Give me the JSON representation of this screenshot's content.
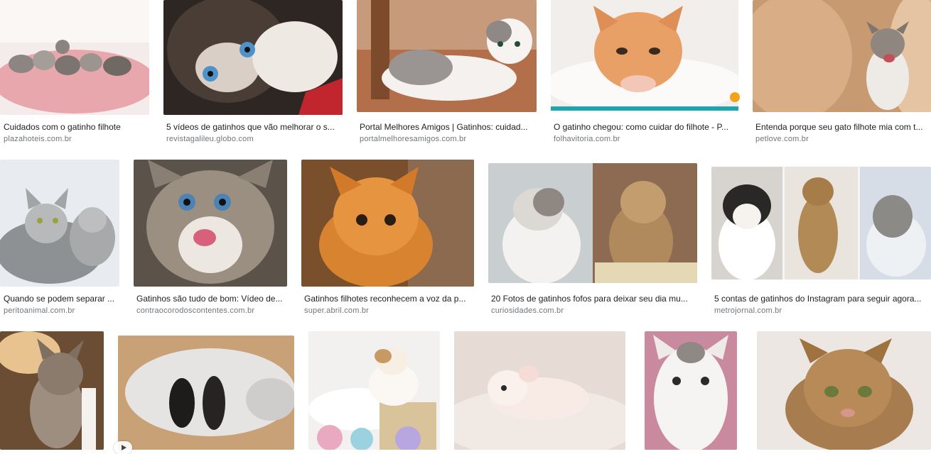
{
  "results": [
    {
      "title": "Cuidados com o gatinho filhote",
      "source": "plazahoteis.com.br"
    },
    {
      "title": "5 vídeos de gatinhos que vão melhorar o s...",
      "source": "revistagalileu.globo.com"
    },
    {
      "title": "Portal Melhores Amigos | Gatinhos: cuidad...",
      "source": "portalmelhoresamigos.com.br"
    },
    {
      "title": "O gatinho chegou: como cuidar do filhote - P...",
      "source": "folhavitoria.com.br"
    },
    {
      "title": "Entenda porque seu gato filhote mia com t...",
      "source": "petlove.com.br"
    },
    {
      "title": "Quando se podem separar ...",
      "source": "peritoanimal.com.br"
    },
    {
      "title": "Gatinhos são tudo de bom: Vídeo de...",
      "source": "contraocorodoscontentes.com.br"
    },
    {
      "title": "Gatinhos filhotes reconhecem a voz da p...",
      "source": "super.abril.com.br"
    },
    {
      "title": "20 Fotos de gatinhos fofos para deixar seu dia mu...",
      "source": "curiosidades.com.br"
    },
    {
      "title": "5 contas de gatinhos do Instagram para seguir agora...",
      "source": "metrojornal.com.br"
    }
  ],
  "icons": {
    "play": "play-icon",
    "site_badge": "site-badge-icon"
  }
}
